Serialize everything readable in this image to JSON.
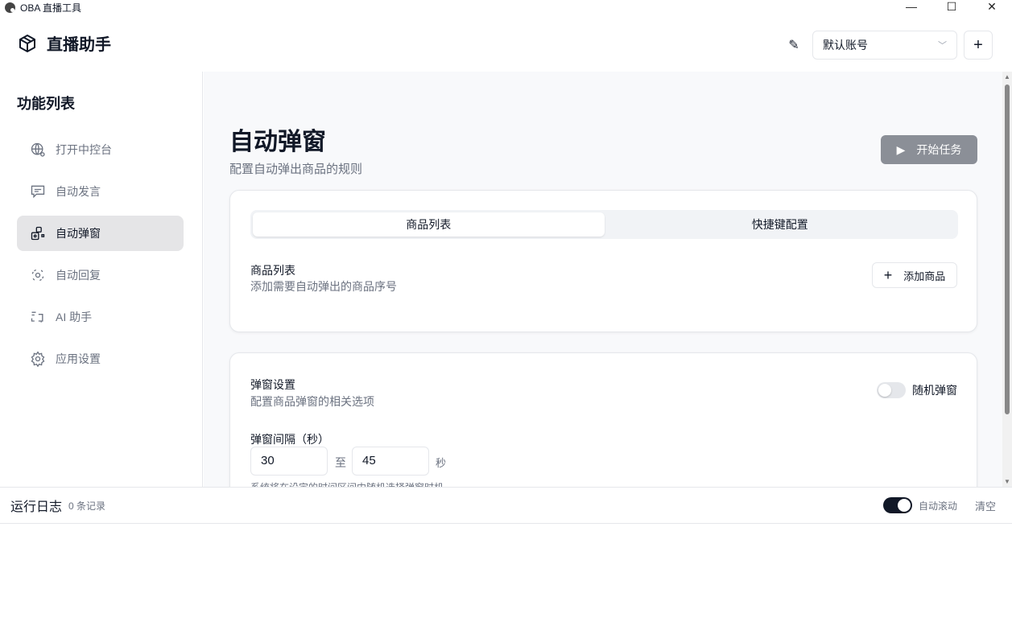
{
  "window": {
    "title": "OBA 直播工具"
  },
  "header": {
    "brand": "直播助手",
    "account": "默认账号"
  },
  "sidebar": {
    "title": "功能列表",
    "items": [
      {
        "label": "打开中控台",
        "icon": "globe-icon"
      },
      {
        "label": "自动发言",
        "icon": "message-icon"
      },
      {
        "label": "自动弹窗",
        "icon": "popup-icon",
        "active": true
      },
      {
        "label": "自动回复",
        "icon": "orbit-icon"
      },
      {
        "label": "AI 助手",
        "icon": "ai-icon"
      },
      {
        "label": "应用设置",
        "icon": "gear-icon"
      }
    ]
  },
  "main": {
    "title": "自动弹窗",
    "subtitle": "配置自动弹出商品的规则",
    "start_label": "开始任务",
    "tabs": [
      {
        "label": "商品列表",
        "active": true
      },
      {
        "label": "快捷键配置"
      }
    ],
    "products": {
      "title": "商品列表",
      "desc": "添加需要自动弹出的商品序号",
      "add_label": "添加商品"
    },
    "settings": {
      "title": "弹窗设置",
      "desc": "配置商品弹窗的相关选项",
      "random_label": "随机弹窗",
      "random_on": false,
      "interval_label": "弹窗间隔（秒）",
      "min": "30",
      "to": "至",
      "max": "45",
      "unit": "秒",
      "hint": "系统将在设定的时间区间内随机选择弹窗时机"
    }
  },
  "log": {
    "title": "运行日志",
    "count": "0 条记录",
    "autoscroll_label": "自动滚动",
    "autoscroll_on": true,
    "clear_label": "清空"
  },
  "colors": {
    "primary": "#111827",
    "disabled_button": "#8b8f97"
  }
}
